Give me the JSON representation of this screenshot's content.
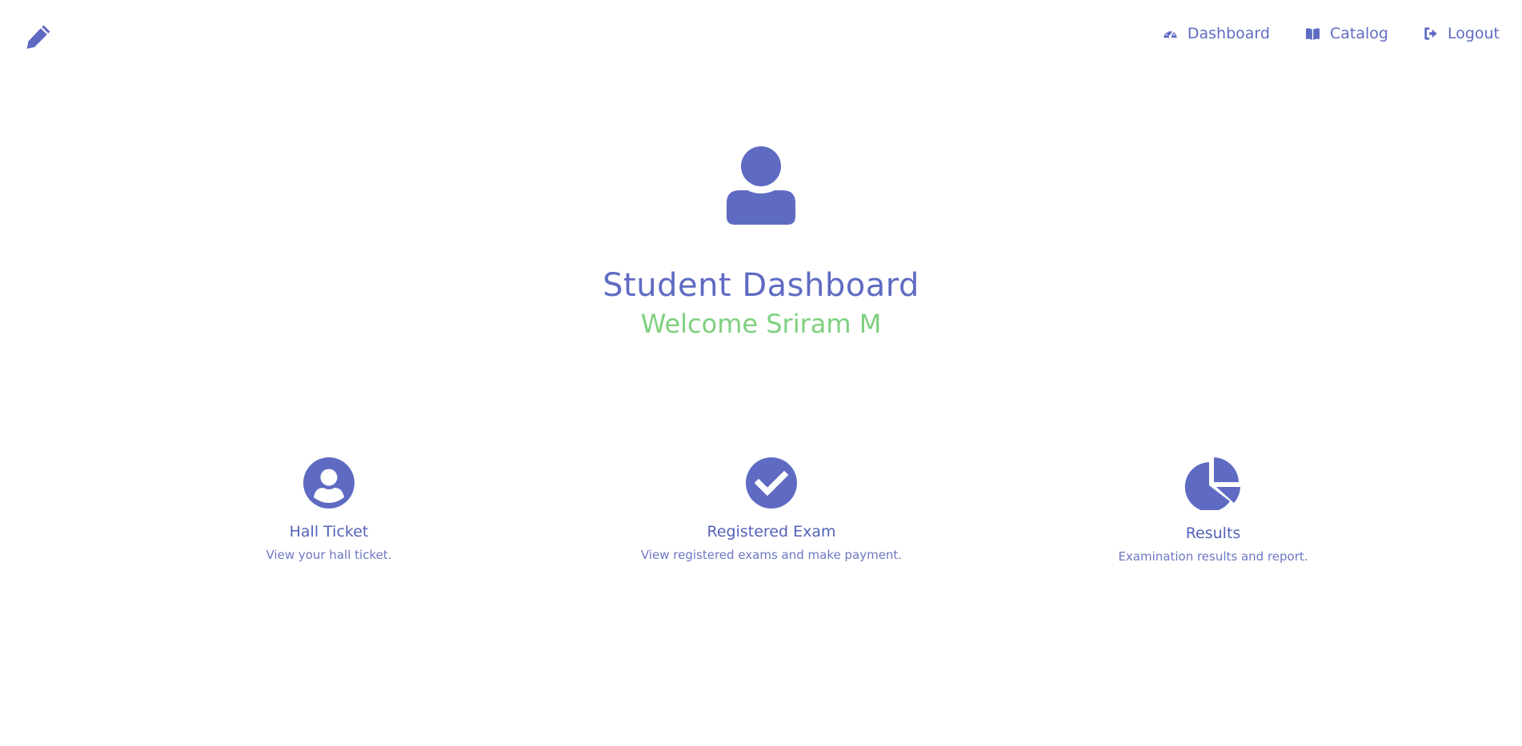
{
  "colors": {
    "primary": "#5f6bc2",
    "accent_green": "#7ed07e",
    "background": "#ffffff"
  },
  "navbar": {
    "brand_icon": "pencil-icon",
    "links": [
      {
        "label": "Dashboard",
        "icon": "dashboard-icon"
      },
      {
        "label": "Catalog",
        "icon": "book-icon"
      },
      {
        "label": "Logout",
        "icon": "logout-icon"
      }
    ]
  },
  "hero": {
    "icon": "user-icon",
    "title": "Student Dashboard",
    "subtitle": "Welcome Sriram M"
  },
  "cards": [
    {
      "title": "Hall Ticket",
      "description": "View your hall ticket.",
      "icon": "user-circle-icon"
    },
    {
      "title": "Registered Exam",
      "description": "View registered exams and make payment.",
      "icon": "check-circle-icon"
    },
    {
      "title": "Results",
      "description": "Examination results and report.",
      "icon": "pie-chart-icon"
    }
  ]
}
